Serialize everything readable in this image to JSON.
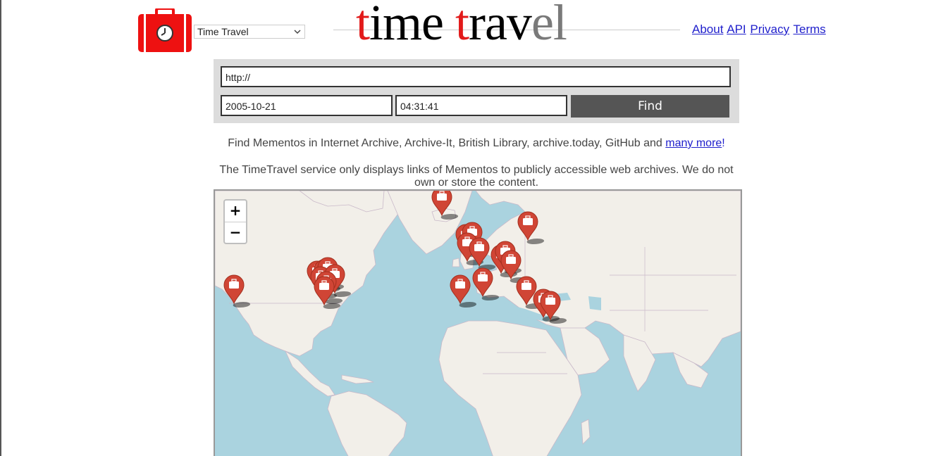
{
  "header": {
    "logo_icon": "suitcase-clock-icon",
    "service_select": {
      "selected": "Time Travel"
    },
    "title_parts": [
      "t",
      "ime",
      " ",
      "t",
      "rav",
      "el"
    ],
    "nav": [
      "About",
      "API",
      "Privacy",
      "Terms"
    ]
  },
  "form": {
    "url_value": "http://",
    "date_value": "2005-10-21",
    "time_value": "04:31:41",
    "find_label": "Find"
  },
  "info": {
    "line1_text": "Find Mementos in Internet Archive, Archive-It, British Library, archive.today, GitHub and ",
    "line1_link": "many more",
    "line1_bang": "!",
    "line2_text": "The TimeTravel service only displays links of Mementos to publicly accessible web archives. We do not own or store the content."
  },
  "map": {
    "zoom_in": "+",
    "zoom_out": "−",
    "pin_icon": "archive-marker-icon",
    "pin_color": "#d04535"
  },
  "colors": {
    "title_red": "#e21a1a",
    "title_grey": "#7a7a7a",
    "button_bg": "#555555",
    "form_bg": "#dcdcdc",
    "water": "#aad3df",
    "land": "#f2efe9",
    "link": "#2020cc"
  }
}
